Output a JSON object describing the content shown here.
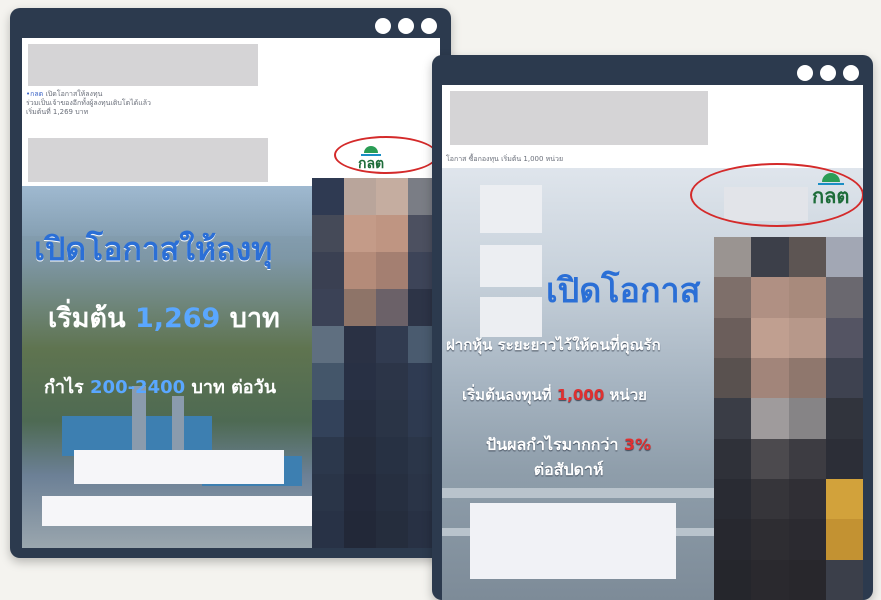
{
  "left_ad": {
    "caption_lines": [
      "เปิดโอกาสให้ลงทุน",
      "ร่วมเป็นเจ้าของอีกทั้งผู้ลงทุนเติบโตได้แล้ว",
      "เริ่มต้นที่ 1,269 บาท"
    ],
    "caption_link": "•กลต",
    "logo_text": "กลต",
    "headline": "เปิดโอกาสให้ลงทุ",
    "price_prefix": "เริ่มต้น",
    "price_value": "1,269",
    "price_suffix": "บาท",
    "profit_prefix": "กำไร",
    "profit_value": "200-2400",
    "profit_suffix": "บาท ต่อวัน"
  },
  "right_ad": {
    "caption_line": "โอกาส ซื้อกองทุน เริ่มต้น 1,000 หน่วย",
    "logo_text": "กลต",
    "headline": "เปิดโอกาส",
    "subline": "ฝากหุ้น ระยะยาวไว้ให้คนที่คุณรัก",
    "start_prefix": "เริ่มต้นลงทุนที่",
    "start_value": "1,000",
    "start_suffix": "หน่วย",
    "dividend_prefix": "ปันผลกำไรมากกว่า",
    "dividend_value": "3%",
    "dividend_suffix": "ต่อสัปดาห์"
  },
  "colors": {
    "frame": "#2c3a4e",
    "headline_blue": "#2b6fd6",
    "price_blue": "#5aa7ff",
    "accent_red": "#e03030",
    "logo_green": "#1e6d3a",
    "annotation_red": "#d42a2a"
  }
}
